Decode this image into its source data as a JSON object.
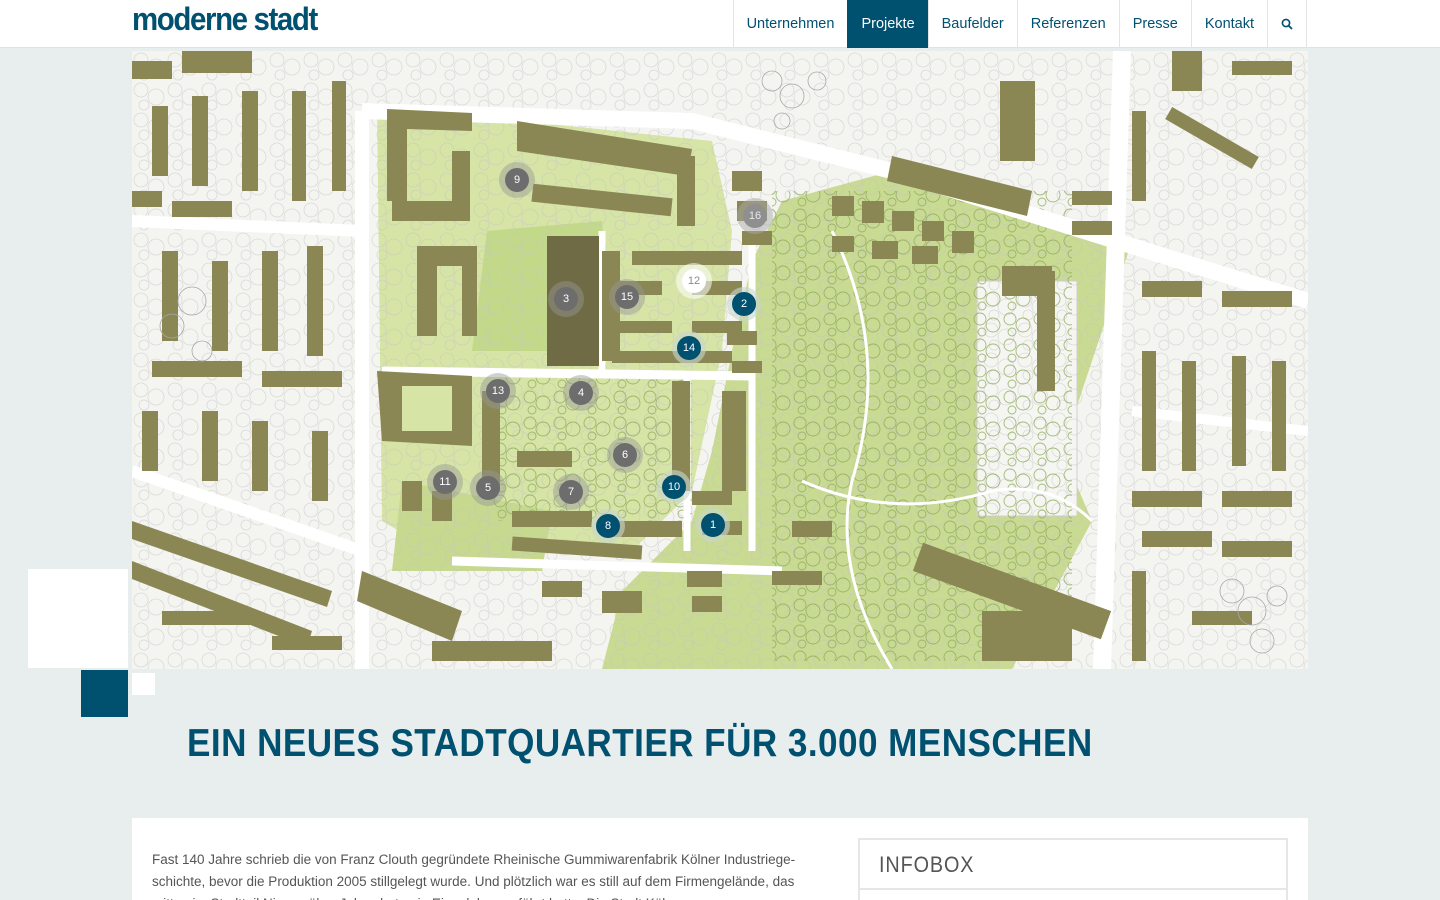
{
  "header": {
    "logo": "moderne stadt",
    "nav": [
      {
        "label": "Unternehmen",
        "active": false
      },
      {
        "label": "Projekte",
        "active": true
      },
      {
        "label": "Baufelder",
        "active": false
      },
      {
        "label": "Referenzen",
        "active": false
      },
      {
        "label": "Presse",
        "active": false
      },
      {
        "label": "Kontakt",
        "active": false
      }
    ],
    "search_icon": "search-icon"
  },
  "map": {
    "markers": [
      {
        "label": "9",
        "style": "grey"
      },
      {
        "label": "16",
        "style": "light"
      },
      {
        "label": "12",
        "style": "white"
      },
      {
        "label": "3",
        "style": "grey"
      },
      {
        "label": "15",
        "style": "grey"
      },
      {
        "label": "2",
        "style": "blue"
      },
      {
        "label": "14",
        "style": "blue"
      },
      {
        "label": "13",
        "style": "grey"
      },
      {
        "label": "4",
        "style": "grey"
      },
      {
        "label": "6",
        "style": "grey"
      },
      {
        "label": "11",
        "style": "grey"
      },
      {
        "label": "5",
        "style": "grey"
      },
      {
        "label": "7",
        "style": "grey"
      },
      {
        "label": "10",
        "style": "blue"
      },
      {
        "label": "8",
        "style": "blue"
      },
      {
        "label": "1",
        "style": "blue"
      }
    ]
  },
  "headline": "EIN NEUES STADTQUARTIER FÜR 3.000 MENSCHEN",
  "intro": "Fast 140 Jahre schrieb die von Franz Clouth gegründete Rheinische Gummiwarenfabrik Kölner Industriege-schichte, bevor die Produktion 2005 stillgelegt wurde. Und plötzlich war es still auf dem Firmengelände, das mitten im Stadtteil Nippes über Jahrzehnte ein Eigenleben geführt hatte. Die Stadt Köln",
  "infobox": {
    "title": "INFOBOX"
  },
  "colors": {
    "brand": "#005070",
    "background": "#e8eeee",
    "park": "#c6d98f",
    "building": "#8a8754"
  }
}
